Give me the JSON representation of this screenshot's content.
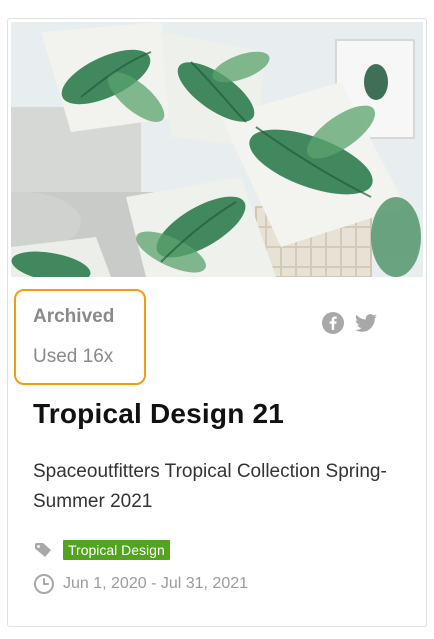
{
  "card": {
    "status": "Archived",
    "usage": "Used 16x",
    "title": "Tropical Design 21",
    "description": "Spaceoutfitters Tropical Collection Spring-Summer 2021",
    "tag": "Tropical Design",
    "date_range": "Jun 1, 2020 - Jul 31, 2021"
  },
  "icons": {
    "share": [
      "facebook-icon",
      "twitter-icon"
    ],
    "tag": "tag-icon",
    "date": "clock-icon"
  },
  "colors": {
    "tag_bg": "#52a31e",
    "highlight": "#f39c12",
    "muted_text": "#8a8a8a",
    "icon_gray": "#a8a8a8"
  }
}
